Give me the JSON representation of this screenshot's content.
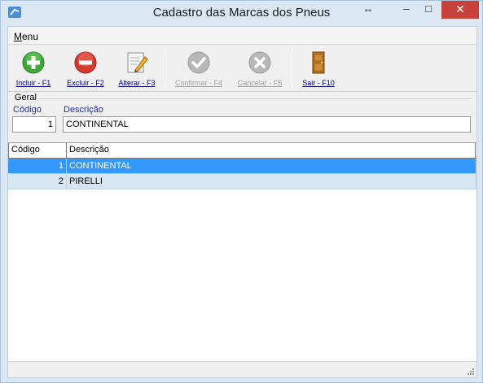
{
  "window": {
    "title": "Cadastro das Marcas dos Pneus"
  },
  "titlebar": {
    "resize_glyph": "↔",
    "min_glyph": "–",
    "max_glyph": "□",
    "close_glyph": "✕"
  },
  "menu": {
    "menu_label": "Menu",
    "menu_underline": "M",
    "menu_rest": "enu"
  },
  "toolbar": {
    "incluir": {
      "label": "Incluir - F1",
      "icon": "plus-circle-green"
    },
    "excluir": {
      "label": "Excluir - F2",
      "icon": "minus-circle-red"
    },
    "alterar": {
      "label": "Alterar - F3",
      "icon": "edit-document"
    },
    "confirmar": {
      "label": "Confirmar - F4",
      "icon": "check-circle-gray",
      "enabled": false
    },
    "cancelar": {
      "label": "Cancelar - F5",
      "icon": "x-circle-gray",
      "enabled": false
    },
    "sair": {
      "label": "Sair - F10",
      "icon": "door"
    }
  },
  "form": {
    "group_label": "Geral",
    "codigo_label": "Código",
    "descricao_label": "Descrição",
    "codigo_value": "1",
    "descricao_value": "CONTINENTAL"
  },
  "grid": {
    "columns": [
      "Código",
      "Descrição"
    ],
    "rows": [
      {
        "codigo": "1",
        "descricao": "CONTINENTAL",
        "selected": true
      },
      {
        "codigo": "2",
        "descricao": "PIRELLI",
        "selected": false
      }
    ]
  },
  "colors": {
    "selection": "#3399ff",
    "row_alt": "#d7e6f3",
    "close_button": "#c7413a",
    "field_label": "#1f2fa8"
  }
}
